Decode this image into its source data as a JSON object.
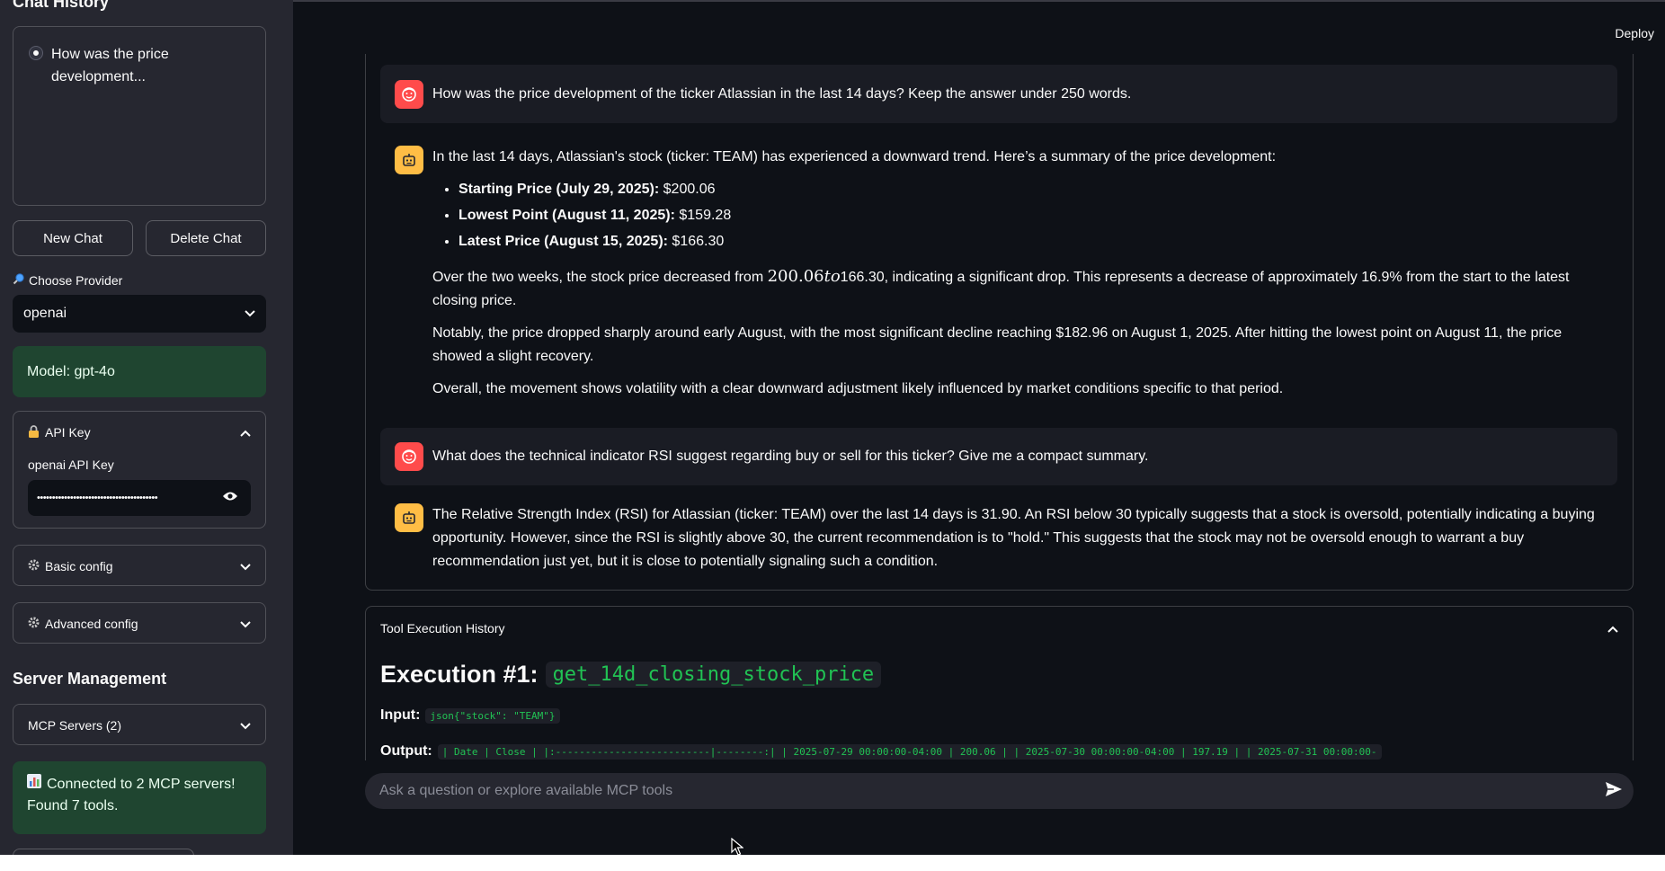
{
  "sidebar": {
    "title": "Chat History",
    "history_items": [
      "How was the price development..."
    ],
    "new_chat": "New Chat",
    "delete_chat": "Delete Chat",
    "provider_label": "Choose Provider",
    "provider_value": "openai",
    "model_text": "Model: gpt-4o",
    "api_key_header": "API Key",
    "api_key_label": "openai API Key",
    "api_key_masked": "••••••••••••••••••••••••••••••••••••••••",
    "basic_config": "Basic config",
    "advanced_config": "Advanced config",
    "server_title": "Server Management",
    "mcp_servers": "MCP Servers (2)",
    "connection_line1": "Connected to 2 MCP servers!",
    "connection_line2": "Found 7 tools."
  },
  "header": {
    "deploy": "Deploy"
  },
  "messages": {
    "q1": "How was the price development of the ticker Atlassian in the last 14 days? Keep the answer under 250 words.",
    "a1_intro": "In the last 14 days, Atlassian's stock (ticker: TEAM) has experienced a downward trend. Here’s a summary of the price development:",
    "a1_bullets": [
      {
        "label": "Starting Price (July 29, 2025):",
        "value": " $200.06"
      },
      {
        "label": "Lowest Point (August 11, 2025):",
        "value": " $159.28"
      },
      {
        "label": "Latest Price (August 15, 2025):",
        "value": " $166.30"
      }
    ],
    "a1_p1_pre": "Over the two weeks, the stock price decreased from ",
    "a1_p1_math_a": "200.06",
    "a1_p1_math_b": "to",
    "a1_p1_math_c": "166.30",
    "a1_p1_post": ", indicating a significant drop. This represents a decrease of approximately 16.9% from the start to the latest closing price.",
    "a1_p2": "Notably, the price dropped sharply around early August, with the most significant decline reaching $182.96 on August 1, 2025. After hitting the lowest point on August 11, the price showed a slight recovery.",
    "a1_p3": "Overall, the movement shows volatility with a clear downward adjustment likely influenced by market conditions specific to that period.",
    "q2": "What does the technical indicator RSI suggest regarding buy or sell for this ticker? Give me a compact summary.",
    "a2": "The Relative Strength Index (RSI) for Atlassian (ticker: TEAM) over the last 14 days is 31.90. An RSI below 30 typically suggests that a stock is oversold, potentially indicating a buying opportunity. However, since the RSI is slightly above 30, the current recommendation is to \"hold.\" This suggests that the stock may not be oversold enough to warrant a buy recommendation just yet, but it is close to potentially signaling such a condition."
  },
  "tools": {
    "header": "Tool Execution History",
    "exec_title": "Execution #1:",
    "exec_name": "get_14d_closing_stock_price",
    "input_label": "Input:",
    "input_value": "json{\"stock\": \"TEAM\"}",
    "output_label": "Output:",
    "output_value": "| Date                      |   Close | |:--------------------------|--------:| | 2025-07-29 00:00:00-04:00 |  200.06 | | 2025-07-30 00:00:00-04:00 |  197.19 | | 2025-07-31 00:00:00-"
  },
  "chat_input": {
    "placeholder": "Ask a question or explore available MCP tools"
  },
  "colors": {
    "accent": "#ff4b4b",
    "bot": "#ffbd45",
    "success": "#1f4530",
    "code": "#21c354"
  }
}
